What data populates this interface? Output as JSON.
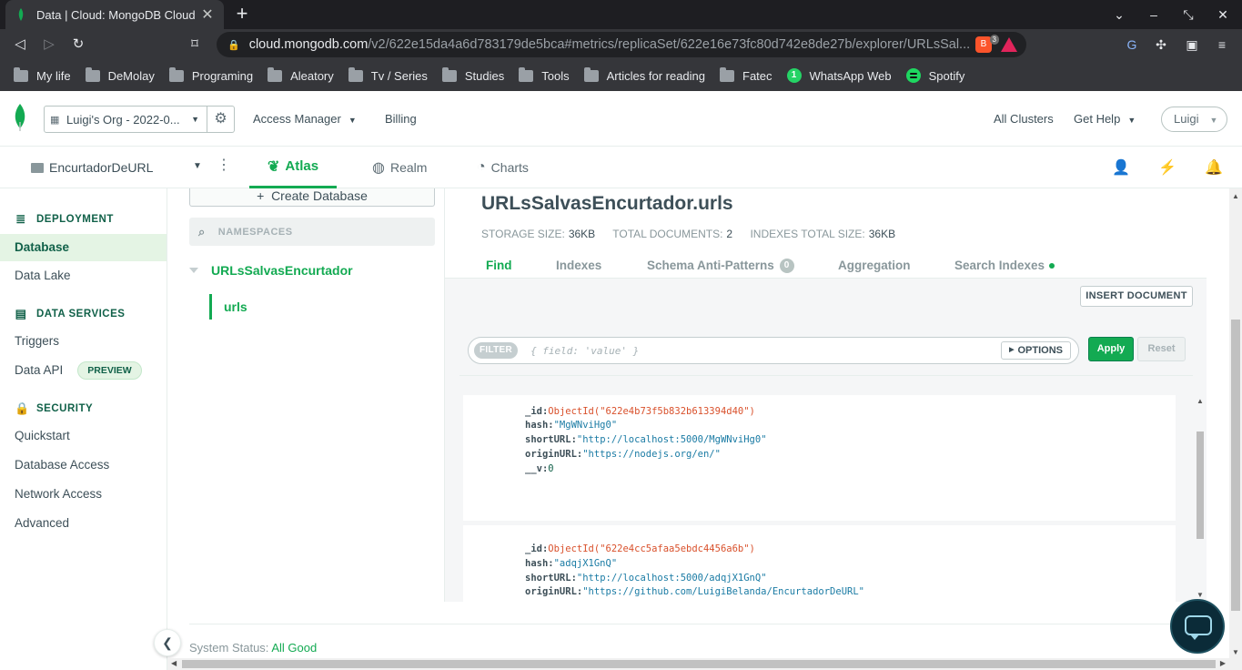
{
  "browser": {
    "tab_title": "Data | Cloud: MongoDB Cloud",
    "url_host": "cloud.mongodb.com",
    "url_rest": "/v2/622e15da4a6d783179de5bca#metrics/replicaSet/622e16e73fc80d742e8de27b/explorer/URLsSal...",
    "brave_count": "3",
    "bookmarks": [
      "My life",
      "DeMolay",
      "Programing",
      "Aleatory",
      "Tv / Series",
      "Studies",
      "Tools",
      "Articles for reading",
      "Fatec",
      "WhatsApp Web",
      "Spotify"
    ],
    "whatsapp_badge": "1"
  },
  "org": {
    "name": "Luigi's Org - 2022-0...",
    "access_manager": "Access Manager",
    "billing": "Billing",
    "all_clusters": "All Clusters",
    "get_help": "Get Help",
    "user": "Luigi"
  },
  "project": {
    "name": "EncurtadorDeURL",
    "tabs": [
      "Atlas",
      "Realm",
      "Charts"
    ]
  },
  "sidebar": {
    "deployment": "DEPLOYMENT",
    "database": "Database",
    "data_lake": "Data Lake",
    "data_services": "DATA SERVICES",
    "triggers": "Triggers",
    "data_api": "Data API",
    "preview": "PREVIEW",
    "security": "SECURITY",
    "quickstart": "Quickstart",
    "database_access": "Database Access",
    "network_access": "Network Access",
    "advanced": "Advanced"
  },
  "namespaces": {
    "create_database": "Create Database",
    "search_placeholder": "NAMESPACES",
    "database": "URLsSalvasEncurtador",
    "collection": "urls"
  },
  "collection": {
    "title": "URLsSalvasEncurtador.urls",
    "storage_label": "STORAGE SIZE:",
    "storage_value": "36KB",
    "docs_label": "TOTAL DOCUMENTS:",
    "docs_value": "2",
    "indexes_label": "INDEXES TOTAL SIZE:",
    "indexes_value": "36KB",
    "tabs": {
      "find": "Find",
      "indexes": "Indexes",
      "schema": "Schema Anti-Patterns",
      "schema_count": "0",
      "aggregation": "Aggregation",
      "search": "Search Indexes"
    },
    "insert_document": "INSERT DOCUMENT",
    "filter_label": "FILTER",
    "filter_placeholder": "{ field: 'value' }",
    "options": "OPTIONS",
    "apply": "Apply",
    "reset": "Reset"
  },
  "documents": [
    {
      "id": "ObjectId(\"622e4b73f5b832b613394d40\")",
      "hash": "\"MgWNviHg0\"",
      "shortURL": "\"http://localhost:5000/MgWNviHg0\"",
      "originURL": "\"https://nodejs.org/en/\"",
      "v": "0"
    },
    {
      "id": "ObjectId(\"622e4cc5afaa5ebdc4456a6b\")",
      "hash": "\"adqjX1GnQ\"",
      "shortURL": "\"http://localhost:5000/adqjX1GnQ\"",
      "originURL": "\"https://github.com/LuigiBelanda/EncurtadorDeURL\""
    }
  ],
  "field_names": {
    "id": "_id:",
    "hash": "hash:",
    "shortURL": "shortURL:",
    "originURL": "originURL:",
    "v": "__v:"
  },
  "footer": {
    "status_label": "System Status:",
    "status_value": "All Good"
  },
  "colors": {
    "accent": "#13aa52",
    "dark_green": "#116149",
    "text": "#3d4f58"
  }
}
